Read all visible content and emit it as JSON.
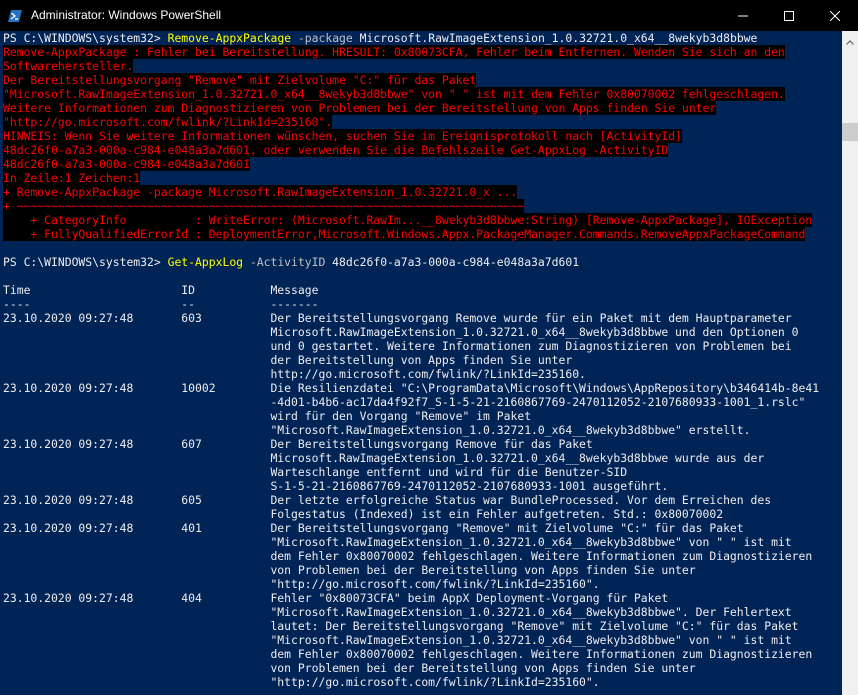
{
  "window": {
    "title": "Administrator: Windows PowerShell",
    "icons": {
      "app": "powershell-icon",
      "minimize": "minimize-icon",
      "maximize": "maximize-icon",
      "close": "close-icon",
      "scroll_up": "chevron-up-icon"
    },
    "colors": {
      "background": "#012456",
      "error_text": "#ff0000",
      "error_background": "#000000",
      "command": "#ffff00",
      "text": "#eeedf0",
      "parameter": "#c0c0c0"
    }
  },
  "console": {
    "cmd1": {
      "prompt": "PS C:\\WINDOWS\\system32> ",
      "command": "Remove-AppxPackage",
      "parameter": " -package",
      "argument": " Microsoft.RawImageExtension_1.0.32721.0_x64__8wekyb3d8bbwe"
    },
    "error_lines": [
      "Remove-AppxPackage : Fehler bei Bereitstellung. HRESULT: 0x80073CFA, Fehler beim Entfernen. Wenden Sie sich an den",
      "Softwarehersteller.",
      "Der Bereitstellungsvorgang \"Remove\" mit Zielvolume \"C:\" für das Paket",
      "\"Microsoft.RawImageExtension_1.0.32721.0_x64__8wekyb3d8bbwe\" von \" \" ist mit dem Fehler 0x80070002 fehlgeschlagen.",
      "Weitere Informationen zum Diagnostizieren von Problemen bei der Bereitstellung von Apps finden Sie unter",
      "\"http://go.microsoft.com/fwlink/?LinkId=235160\".",
      "HINWEIS: Wenn Sie weitere Informationen wünschen, suchen Sie im Ereignisprotokoll nach [ActivityId]",
      "48dc26f0-a7a3-000a-c984-e048a3a7d601, oder verwenden Sie die Befehlszeile Get-AppxLog -ActivityID",
      "48dc26f0-a7a3-000a-c984-e048a3a7d601",
      "In Zeile:1 Zeichen:1",
      "+ Remove-AppxPackage -package Microsoft.RawImageExtension_1.0.32721.0_x ...",
      "+ ~~~~~~~~~~~~~~~~~~~~~~~~~~~~~~~~~~~~~~~~~~~~~~~~~~~~~~~~~~~~~~~~~~~~~~~~~~",
      "    + CategoryInfo          : WriteError: (Microsoft.RawIm...__8wekyb3d8bbwe:String) [Remove-AppxPackage], IOException",
      "    + FullyQualifiedErrorId : DeploymentError,Microsoft.Windows.Appx.PackageManager.Commands.RemoveAppxPackageCommand"
    ],
    "cmd2": {
      "prompt": "PS C:\\WINDOWS\\system32> ",
      "command": "Get-AppxLog",
      "parameter": " -ActivityID",
      "argument": " 48dc26f0-a7a3-000a-c984-e048a3a7d601"
    },
    "log_lines": [
      "Time                      ID           Message",
      "----                      --           -------",
      "23.10.2020 09:27:48       603          Der Bereitstellungsvorgang Remove wurde für ein Paket mit dem Hauptparameter",
      "                                       Microsoft.RawImageExtension_1.0.32721.0_x64__8wekyb3d8bbwe und den Optionen 0",
      "                                       und 0 gestartet. Weitere Informationen zum Diagnostizieren von Problemen bei",
      "                                       der Bereitstellung von Apps finden Sie unter",
      "                                       http://go.microsoft.com/fwlink/?LinkId=235160.",
      "23.10.2020 09:27:48       10002        Die Resilienzdatei \"C:\\ProgramData\\Microsoft\\Windows\\AppRepository\\b346414b-8e41",
      "                                       -4d01-b4b6-ac17da4f92f7_S-1-5-21-2160867769-2470112052-2107680933-1001_1.rslc\"",
      "                                       wird für den Vorgang \"Remove\" im Paket",
      "                                       \"Microsoft.RawImageExtension_1.0.32721.0_x64__8wekyb3d8bbwe\" erstellt.",
      "23.10.2020 09:27:48       607          Der Bereitstellungsvorgang Remove für das Paket",
      "                                       Microsoft.RawImageExtension_1.0.32721.0_x64__8wekyb3d8bbwe wurde aus der",
      "                                       Warteschlange entfernt und wird für die Benutzer-SID",
      "                                       S-1-5-21-2160867769-2470112052-2107680933-1001 ausgeführt.",
      "23.10.2020 09:27:48       605          Der letzte erfolgreiche Status war BundleProcessed. Vor dem Erreichen des",
      "                                       Folgestatus (Indexed) ist ein Fehler aufgetreten. Std.: 0x80070002",
      "23.10.2020 09:27:48       401          Der Bereitstellungsvorgang \"Remove\" mit Zielvolume \"C:\" für das Paket",
      "                                       \"Microsoft.RawImageExtension_1.0.32721.0_x64__8wekyb3d8bbwe\" von \" \" ist mit",
      "                                       dem Fehler 0x80070002 fehlgeschlagen. Weitere Informationen zum Diagnostizieren",
      "                                       von Problemen bei der Bereitstellung von Apps finden Sie unter",
      "                                       \"http://go.microsoft.com/fwlink/?LinkId=235160\".",
      "23.10.2020 09:27:48       404          Fehler \"0x80073CFA\" beim AppX Deployment-Vorgang für Paket",
      "                                       \"Microsoft.RawImageExtension_1.0.32721.0_x64__8wekyb3d8bbwe\". Der Fehlertext",
      "                                       lautet: Der Bereitstellungsvorgang \"Remove\" mit Zielvolume \"C:\" für das Paket",
      "                                       \"Microsoft.RawImageExtension_1.0.32721.0_x64__8wekyb3d8bbwe\" von \" \" ist mit",
      "                                       dem Fehler 0x80070002 fehlgeschlagen. Weitere Informationen zum Diagnostizieren",
      "                                       von Problemen bei der Bereitstellung von Apps finden Sie unter",
      "                                       \"http://go.microsoft.com/fwlink/?LinkId=235160\"."
    ]
  }
}
